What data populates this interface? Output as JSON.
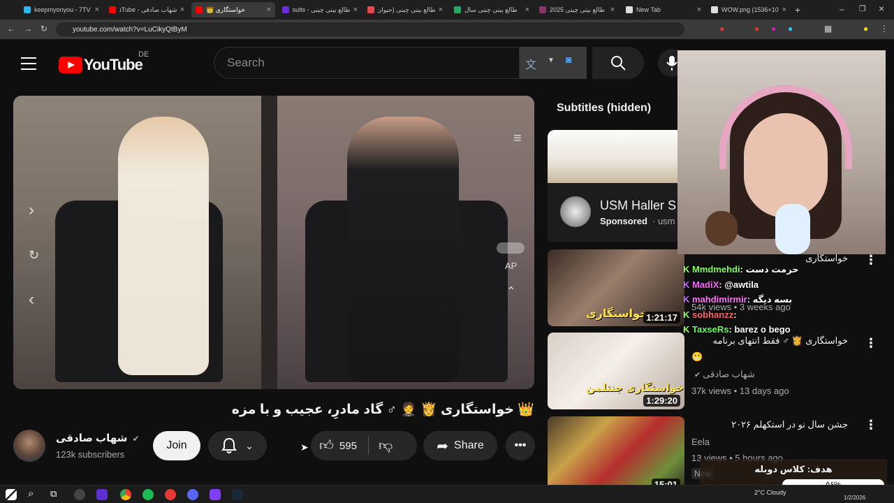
{
  "browser": {
    "tabs": [
      {
        "title": "keepmyonyou - 7TV",
        "color": "#29b6f6"
      },
      {
        "title": "شهاب صادقی - YouTube",
        "color": "#ff0000"
      },
      {
        "title": "خواستگاری 👑",
        "color": "#ff0000",
        "active": true
      },
      {
        "title": "طالع بینی چینی - results",
        "color": "#6c2cd8"
      },
      {
        "title": "طالع بینی چینی (حیوان",
        "color": "#e64a4a"
      },
      {
        "title": "طالع بینی چینی سال",
        "color": "#22aa66"
      },
      {
        "title": "طالع بینی چینی 2025",
        "color": "#883366"
      },
      {
        "title": "New Tab",
        "color": "#dddddd"
      },
      {
        "title": "WOW.png (1536×10",
        "color": "#dddddd"
      }
    ],
    "url": "youtube.com/watch?v=LuCikyQtByM"
  },
  "youtube": {
    "logo_text": "YouTube",
    "country": "DE",
    "search_placeholder": "Search"
  },
  "video": {
    "title": "👑 خواستگاری 👸 🤵 ♂ گاد مادرِ، عجیب و با مزه",
    "overlay_ap": "AP"
  },
  "channel": {
    "name": "شهاب صادقی",
    "subscribers": "123k subscribers",
    "join_label": "Join"
  },
  "actions": {
    "like_count": "595",
    "share_label": "Share"
  },
  "sidebar": {
    "subtitles_label": "Subtitles (hidden)",
    "ad": {
      "title": "USM Haller S",
      "sponsored": "Sponsored",
      "url": "usm"
    },
    "videos": [
      {
        "thumb_text": "خواستگاری",
        "duration": "1:21:17",
        "title": "خواستگاری",
        "views": "54k views",
        "age": "3 weeks ago"
      },
      {
        "thumb_text": "خواستگاری جنتلمن",
        "duration": "1:29:20",
        "title": "خواستگاری 👸 ♂ فقط انتهای برنامه",
        "title2": "😬",
        "channel": "شهاب صادقی",
        "views": "37k views",
        "age": "13 days ago"
      },
      {
        "duration": "15:01",
        "title": "جشن سال نو در استکهلم ۲۰۲۶",
        "channel": "Eela",
        "views": "13 views",
        "age": "5 hours ago",
        "badge": "New"
      }
    ]
  },
  "chat": [
    {
      "user": "Mmdmehdi",
      "text": "حرمت دست",
      "color": "#88ff66"
    },
    {
      "user": "MadiX",
      "text": ": @awtila",
      "color": "#ff66ff"
    },
    {
      "user": "mahdimirmir",
      "text": ": بسه دیگه",
      "color": "#ff77ff"
    },
    {
      "user": "sobhanzz",
      "text": ":",
      "color": "#ff6666"
    },
    {
      "user": "TaxseRs",
      "text": ": barez o bego",
      "color": "#66ff66"
    }
  ],
  "stream_goal": {
    "label": "هدف: کلاس دوبله",
    "progress_text": "۵۶%",
    "progress": 0.56
  },
  "taskbar": {
    "weather": "2°C Cloudy",
    "date": "1/2/2026"
  },
  "colors": {
    "yt_red": "#ff0000",
    "background": "#0f0f0f",
    "chip": "#272727"
  }
}
